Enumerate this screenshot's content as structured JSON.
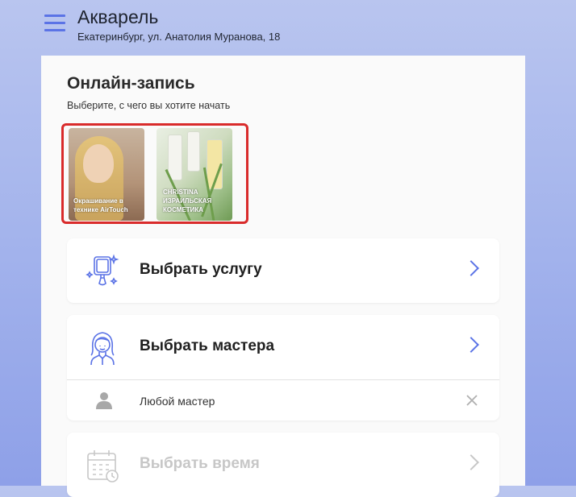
{
  "header": {
    "title": "Акварель",
    "address": "Екатеринбург, ул. Анатолия Муранова, 18"
  },
  "booking": {
    "title": "Онлайн-запись",
    "subtitle": "Выберите, с чего вы хотите начать"
  },
  "promos": [
    {
      "label": "Окрашивание в технике AirTouch"
    },
    {
      "label": "CHRISTINA ИЗРАИЛЬСКАЯ КОСМЕТИКА"
    }
  ],
  "options": {
    "service": "Выбрать услугу",
    "master": "Выбрать мастера",
    "any_master": "Любой мастер",
    "time": "Выбрать время"
  },
  "colors": {
    "accent": "#5b73e6",
    "highlight_border": "#d92b2b",
    "disabled": "#c7c7c7"
  },
  "icons": [
    "menu-icon",
    "mirror-icon",
    "stylist-icon",
    "person-icon",
    "close-icon",
    "calendar-icon",
    "chevron-right-icon"
  ]
}
